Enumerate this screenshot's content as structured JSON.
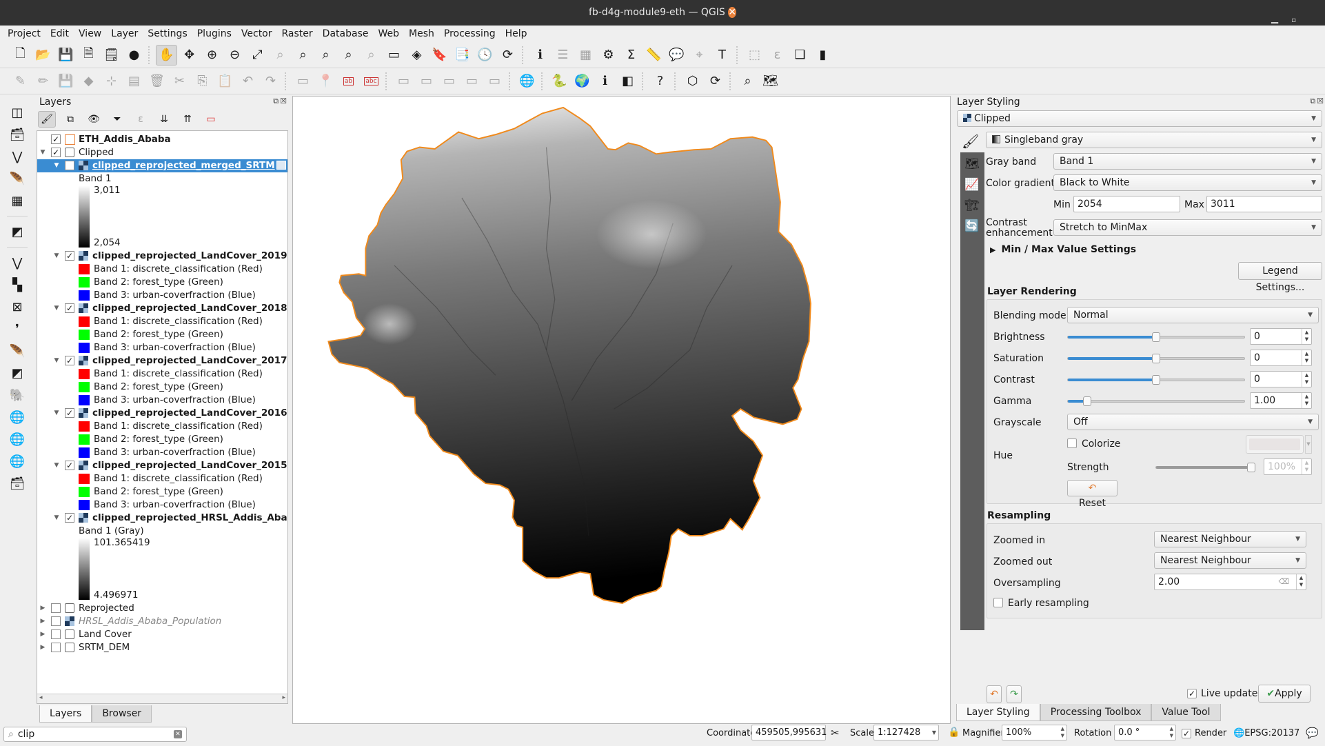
{
  "window": {
    "title": "fb-d4g-module9-eth — QGIS",
    "controls": [
      "minimize",
      "maximize",
      "close"
    ]
  },
  "menu": [
    "Project",
    "Edit",
    "View",
    "Layer",
    "Settings",
    "Plugins",
    "Vector",
    "Raster",
    "Database",
    "Web",
    "Mesh",
    "Processing",
    "Help"
  ],
  "toolbar1": [
    {
      "name": "new-project-icon",
      "glyph": "🗋"
    },
    {
      "name": "open-project-icon",
      "glyph": "📂"
    },
    {
      "name": "save-project-icon",
      "glyph": "💾"
    },
    {
      "name": "new-print-layout-icon",
      "glyph": "🗎"
    },
    {
      "name": "layout-manager-icon",
      "glyph": "🗒"
    },
    {
      "name": "style-manager-icon",
      "glyph": "●"
    },
    {
      "sep": true
    },
    {
      "name": "pan-map-icon",
      "glyph": "✋",
      "active": true
    },
    {
      "name": "pan-to-selection-icon",
      "glyph": "✥"
    },
    {
      "name": "zoom-in-icon",
      "glyph": "⊕"
    },
    {
      "name": "zoom-out-icon",
      "glyph": "⊖"
    },
    {
      "name": "zoom-full-icon",
      "glyph": "⤢"
    },
    {
      "name": "zoom-to-selection-icon",
      "glyph": "⌕",
      "dim": true
    },
    {
      "name": "zoom-to-layer-icon",
      "glyph": "⌕"
    },
    {
      "name": "zoom-native-icon",
      "glyph": "⌕"
    },
    {
      "name": "zoom-last-icon",
      "glyph": "⌕"
    },
    {
      "name": "zoom-next-icon",
      "glyph": "⌕",
      "dim": true
    },
    {
      "name": "new-map-view-icon",
      "glyph": "▭"
    },
    {
      "name": "new-3d-map-view-icon",
      "glyph": "◈"
    },
    {
      "name": "new-bookmark-icon",
      "glyph": "🔖"
    },
    {
      "name": "show-bookmarks-icon",
      "glyph": "📑"
    },
    {
      "name": "temporal-controller-icon",
      "glyph": "🕓"
    },
    {
      "name": "refresh-icon",
      "glyph": "⟳"
    },
    {
      "sep": true
    },
    {
      "name": "identify-features-icon",
      "glyph": "ℹ"
    },
    {
      "name": "open-attribute-table-icon",
      "glyph": "☰",
      "dim": true
    },
    {
      "name": "field-calculator-icon",
      "glyph": "▦",
      "dim": true
    },
    {
      "name": "processing-toolbox-icon",
      "glyph": "⚙"
    },
    {
      "name": "statistical-summary-icon",
      "glyph": "Σ"
    },
    {
      "name": "measure-line-icon",
      "glyph": "📏"
    },
    {
      "name": "map-tips-icon",
      "glyph": "💬"
    },
    {
      "name": "select-by-location-icon",
      "glyph": "⌖",
      "dim": true
    },
    {
      "name": "text-annotation-icon",
      "glyph": "T"
    },
    {
      "sep": true
    },
    {
      "name": "select-features-icon",
      "glyph": "⬚",
      "dim": true
    },
    {
      "name": "select-by-expression-icon",
      "glyph": "ε",
      "dim": true
    },
    {
      "name": "deselect-all-icon",
      "glyph": "❏"
    },
    {
      "name": "new-annotation-layer-icon",
      "glyph": "▮"
    }
  ],
  "toolbar2": [
    {
      "name": "current-edits-icon",
      "glyph": "✎",
      "dim": true
    },
    {
      "name": "toggle-editing-icon",
      "glyph": "✏",
      "dim": true
    },
    {
      "name": "save-layer-edits-icon",
      "glyph": "💾",
      "dim": true
    },
    {
      "name": "add-feature-icon",
      "glyph": "◆",
      "dim": true
    },
    {
      "name": "vertex-tool-icon",
      "glyph": "⊹",
      "dim": true
    },
    {
      "name": "modify-attributes-icon",
      "glyph": "▤",
      "dim": true
    },
    {
      "name": "delete-selected-icon",
      "glyph": "🗑",
      "dim": true
    },
    {
      "name": "cut-features-icon",
      "glyph": "✂",
      "dim": true
    },
    {
      "name": "copy-features-icon",
      "glyph": "⎘",
      "dim": true
    },
    {
      "name": "paste-features-icon",
      "glyph": "📋",
      "dim": true
    },
    {
      "name": "undo-icon",
      "glyph": "↶",
      "dim": true
    },
    {
      "name": "redo-icon",
      "glyph": "↷",
      "dim": true
    },
    {
      "sep": true
    },
    {
      "name": "label-toolbar-icon",
      "glyph": "▭",
      "dim": true
    },
    {
      "name": "pin-labels-icon",
      "glyph": "📍",
      "dim": true
    },
    {
      "name": "layer-labeling-options-icon",
      "glyph": "ab"
    },
    {
      "name": "layer-diagram-options-icon",
      "glyph": "abc"
    },
    {
      "sep": true
    },
    {
      "name": "highlight-pinned-labels-icon",
      "glyph": "▭",
      "dim": true
    },
    {
      "name": "show-hide-labels-icon",
      "glyph": "▭",
      "dim": true
    },
    {
      "name": "move-label-icon",
      "glyph": "▭",
      "dim": true
    },
    {
      "name": "rotate-label-icon",
      "glyph": "▭",
      "dim": true
    },
    {
      "name": "change-label-icon",
      "glyph": "▭",
      "dim": true
    },
    {
      "sep": true
    },
    {
      "name": "geocoder-plugin-icon",
      "glyph": "🌐"
    },
    {
      "sep": true
    },
    {
      "name": "python-console-icon",
      "glyph": "🐍"
    },
    {
      "name": "open-google-earth-icon",
      "glyph": "🌍"
    },
    {
      "name": "identify-plugin-icon",
      "glyph": "ℹ"
    },
    {
      "name": "swipe-tool-icon",
      "glyph": "◧"
    },
    {
      "sep": true
    },
    {
      "name": "qgis-help-icon",
      "glyph": "?"
    },
    {
      "sep": true
    },
    {
      "name": "topology-checker-icon",
      "glyph": "⬡"
    },
    {
      "name": "refresh-table-icon",
      "glyph": "⟳"
    },
    {
      "sep": true
    },
    {
      "name": "search-plugin-icon",
      "glyph": "⌕"
    },
    {
      "name": "quickmap-services-icon",
      "glyph": "🗺"
    }
  ],
  "leftbar": [
    {
      "name": "data-source-manager-icon",
      "glyph": "◫"
    },
    {
      "name": "new-geopackage-layer-icon",
      "glyph": "🗃"
    },
    {
      "name": "new-shapefile-layer-icon",
      "glyph": "⋁"
    },
    {
      "name": "new-temporary-scratch-layer-icon",
      "glyph": "🪶"
    },
    {
      "name": "new-virtual-layer-icon",
      "glyph": "▦"
    },
    {
      "sep": true
    },
    {
      "name": "new-mesh-layer-icon",
      "glyph": "◩"
    },
    {
      "sep": true
    },
    {
      "name": "add-vector-layer-icon",
      "glyph": "⋁"
    },
    {
      "name": "add-raster-layer-icon",
      "glyph": "▚"
    },
    {
      "name": "add-mesh-layer-icon",
      "glyph": "⊠"
    },
    {
      "name": "add-delimited-text-layer-icon",
      "glyph": "❜"
    },
    {
      "name": "add-spatialite-layer-icon",
      "glyph": "🪶"
    },
    {
      "name": "add-virtual-layer-icon",
      "glyph": "◩"
    },
    {
      "name": "add-postgis-layer-icon",
      "glyph": "🐘"
    },
    {
      "name": "add-wms-layer-icon",
      "glyph": "🌐"
    },
    {
      "name": "add-wfs-layer-icon",
      "glyph": "🌐"
    },
    {
      "name": "add-wcs-layer-icon",
      "glyph": "🌐"
    },
    {
      "name": "add-geopackage-layer-icon",
      "glyph": "🗃"
    }
  ],
  "layers_panel": {
    "title": "Layers",
    "tree": [
      {
        "label": "ETH_Addis_Ababa",
        "type": "polygon",
        "checked": true,
        "bold": true,
        "depth": 0,
        "expander": "none"
      },
      {
        "label": "Clipped",
        "type": "group",
        "checked": true,
        "depth": 0,
        "expander": "open"
      },
      {
        "label": "clipped_reprojected_merged_SRTM",
        "type": "raster",
        "checked": true,
        "bold": true,
        "selected": true,
        "depth": 1,
        "expander": "open",
        "legend": {
          "kind": "gradient",
          "band": "Band 1",
          "max": "3,011",
          "min": "2,054"
        }
      },
      {
        "label": "clipped_reprojected_LandCover_2019",
        "type": "raster",
        "checked": true,
        "bold": true,
        "depth": 1,
        "expander": "open",
        "legend": {
          "kind": "bands"
        }
      },
      {
        "label": "clipped_reprojected_LandCover_2018",
        "type": "raster",
        "checked": true,
        "bold": true,
        "depth": 1,
        "expander": "open",
        "legend": {
          "kind": "bands"
        }
      },
      {
        "label": "clipped_reprojected_LandCover_2017",
        "type": "raster",
        "checked": true,
        "bold": true,
        "depth": 1,
        "expander": "open",
        "legend": {
          "kind": "bands"
        }
      },
      {
        "label": "clipped_reprojected_LandCover_2016",
        "type": "raster",
        "checked": true,
        "bold": true,
        "depth": 1,
        "expander": "open",
        "legend": {
          "kind": "bands"
        }
      },
      {
        "label": "clipped_reprojected_LandCover_2015",
        "type": "raster",
        "checked": true,
        "bold": true,
        "depth": 1,
        "expander": "open",
        "legend": {
          "kind": "bands"
        }
      },
      {
        "label": "clipped_reprojected_HRSL_Addis_Ababa",
        "type": "raster",
        "checked": true,
        "bold": true,
        "depth": 1,
        "expander": "open",
        "legend": {
          "kind": "gradient",
          "band": "Band 1 (Gray)",
          "max": "101.365419",
          "min": "4.496971"
        }
      },
      {
        "label": "Reprojected",
        "type": "group",
        "checked": false,
        "depth": 0,
        "expander": "closed"
      },
      {
        "label": "HRSL_Addis_Ababa_Population",
        "type": "raster",
        "checked": false,
        "italic": true,
        "depth": 0,
        "expander": "closed"
      },
      {
        "label": "Land Cover",
        "type": "group",
        "checked": false,
        "depth": 0,
        "expander": "closed"
      },
      {
        "label": "SRTM_DEM",
        "type": "group",
        "checked": false,
        "depth": 0,
        "expander": "closed"
      }
    ],
    "band_entries": [
      {
        "label": "Band 1: discrete_classification (Red)",
        "color": "#ff0000"
      },
      {
        "label": "Band 2: forest_type (Green)",
        "color": "#00ff00"
      },
      {
        "label": "Band 3: urban-coverfraction (Blue)",
        "color": "#0000ff"
      }
    ],
    "tabs": [
      "Layers",
      "Browser"
    ],
    "active_tab": "Layers"
  },
  "search": {
    "value": "clip"
  },
  "map": {
    "boundary_color": "#f08a1c"
  },
  "styling": {
    "title": "Layer Styling",
    "layer": "Clipped",
    "renderer": "Singleband gray",
    "gray_band_label": "Gray band",
    "gray_band": "Band 1",
    "color_gradient_label": "Color gradient",
    "color_gradient": "Black to White",
    "min_label": "Min",
    "min": "2054",
    "max_label": "Max",
    "max": "3011",
    "contrast_label_1": "Contrast",
    "contrast_label_2": "enhancement",
    "contrast": "Stretch to MinMax",
    "minmax_settings": "Min / Max Value Settings",
    "legend_settings": "Legend Settings...",
    "rendering_title": "Layer Rendering",
    "blending_label": "Blending mode",
    "blending": "Normal",
    "brightness_label": "Brightness",
    "brightness": "0",
    "brightness_pos": 0.5,
    "saturation_label": "Saturation",
    "saturation": "0",
    "saturation_pos": 0.5,
    "contrast_r_label": "Contrast",
    "contrast_r": "0",
    "contrast_pos": 0.5,
    "gamma_label": "Gamma",
    "gamma": "1.00",
    "gamma_pos": 0.11,
    "grayscale_label": "Grayscale",
    "grayscale": "Off",
    "hue_label": "Hue",
    "colorize_label": "Colorize",
    "colorize": false,
    "strength_label": "Strength",
    "strength": "100%",
    "strength_pos": 1.0,
    "reset": "Reset",
    "resampling_title": "Resampling",
    "zoomed_in_label": "Zoomed in",
    "zoomed_in": "Nearest Neighbour",
    "zoomed_out_label": "Zoomed out",
    "zoomed_out": "Nearest Neighbour",
    "oversampling_label": "Oversampling",
    "oversampling": "2.00",
    "early_resampling_label": "Early resampling",
    "early_resampling": false,
    "live_update_label": "Live update",
    "live_update": true,
    "apply": "Apply",
    "tabs": [
      "Layer Styling",
      "Processing Toolbox",
      "Value Tool"
    ],
    "active_tab": "Layer Styling"
  },
  "status": {
    "coordinate_label": "Coordinate",
    "coordinate": "459505,995631",
    "scale_label": "Scale",
    "scale": "1:127428",
    "magnifier_label": "Magnifier",
    "magnifier": "100%",
    "rotation_label": "Rotation",
    "rotation": "0.0 °",
    "render_label": "Render",
    "render": true,
    "crs": "EPSG:20137"
  }
}
